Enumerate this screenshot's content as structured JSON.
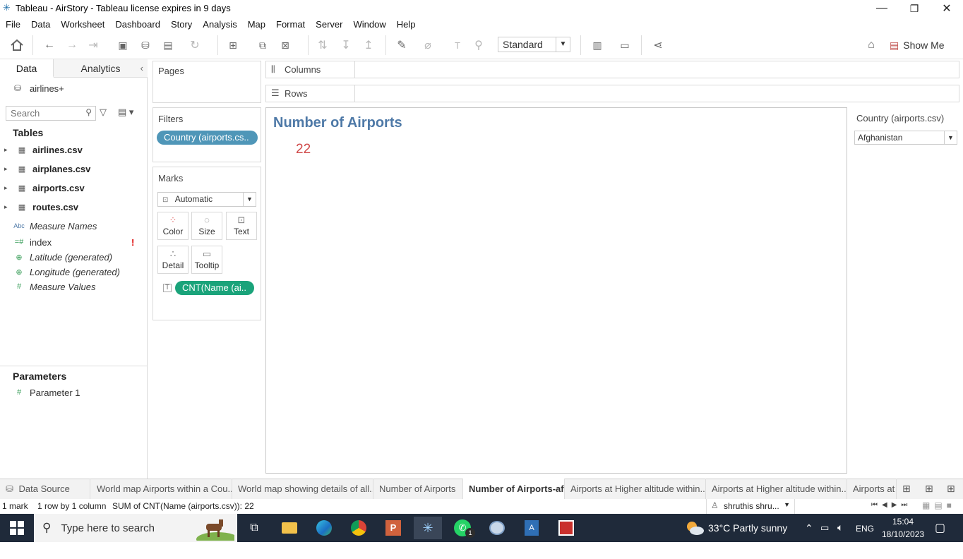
{
  "window": {
    "title": "Tableau - AirStory - Tableau license expires in 9 days"
  },
  "menu": [
    "File",
    "Data",
    "Worksheet",
    "Dashboard",
    "Story",
    "Analysis",
    "Map",
    "Format",
    "Server",
    "Window",
    "Help"
  ],
  "toolbar": {
    "fit_mode": "Standard",
    "show_me_label": "Show Me"
  },
  "datapane": {
    "tab_data": "Data",
    "tab_analytics": "Analytics",
    "datasource": "airlines+",
    "search_placeholder": "Search",
    "tables_heading": "Tables",
    "tables": [
      "airlines.csv",
      "airplanes.csv",
      "airports.csv",
      "routes.csv"
    ],
    "fields": [
      {
        "name": "Measure Names",
        "icon": "Abc",
        "italic": true
      },
      {
        "name": "index",
        "icon": "=#",
        "italic": false,
        "warning": "!"
      },
      {
        "name": "Latitude (generated)",
        "icon": "globe",
        "italic": true
      },
      {
        "name": "Longitude (generated)",
        "icon": "globe",
        "italic": true
      },
      {
        "name": "Measure Values",
        "icon": "#",
        "italic": true
      }
    ],
    "parameters_heading": "Parameters",
    "parameters": [
      "Parameter 1"
    ]
  },
  "cards": {
    "pages_label": "Pages",
    "filters_label": "Filters",
    "filter_pill": "Country (airports.cs..",
    "marks_label": "Marks",
    "mark_type": "Automatic",
    "mark_buttons": [
      "Color",
      "Size",
      "Text",
      "Detail",
      "Tooltip"
    ],
    "text_pill": "CNT(Name (ai..",
    "columns_label": "Columns",
    "rows_label": "Rows"
  },
  "view": {
    "title": "Number of Airports",
    "value": "22",
    "title_color": "#4e79a7",
    "value_color": "#d04a4a"
  },
  "filter_card": {
    "title": "Country (airports.csv)",
    "selected": "Afghanistan"
  },
  "sheet_tabs": [
    {
      "label": "Data Source",
      "active": false
    },
    {
      "label": "World map Airports within a Cou...",
      "active": false
    },
    {
      "label": "World map showing details of all...",
      "active": false
    },
    {
      "label": "Number of Airports",
      "active": false
    },
    {
      "label": "Number of Airports-afg",
      "active": true
    },
    {
      "label": "Airports at Higher altitude within...",
      "active": false
    },
    {
      "label": "Airports at Higher altitude within...",
      "active": false
    },
    {
      "label": "Airports at",
      "active": false
    }
  ],
  "status": {
    "marks": "1 mark",
    "dims": "1 row by 1 column",
    "sum": "SUM of CNT(Name (airports.csv)): 22",
    "user": "shruthis shru..."
  },
  "taskbar": {
    "search_placeholder": "Type here to search",
    "weather": "33°C  Partly sunny",
    "lang": "ENG",
    "time": "15:04",
    "date": "18/10/2023",
    "whatsapp_badge": "1"
  },
  "colors": {
    "filter_pill": "#4f96b8",
    "text_pill": "#1aa37a",
    "taskbar": "#1f2a3a"
  }
}
